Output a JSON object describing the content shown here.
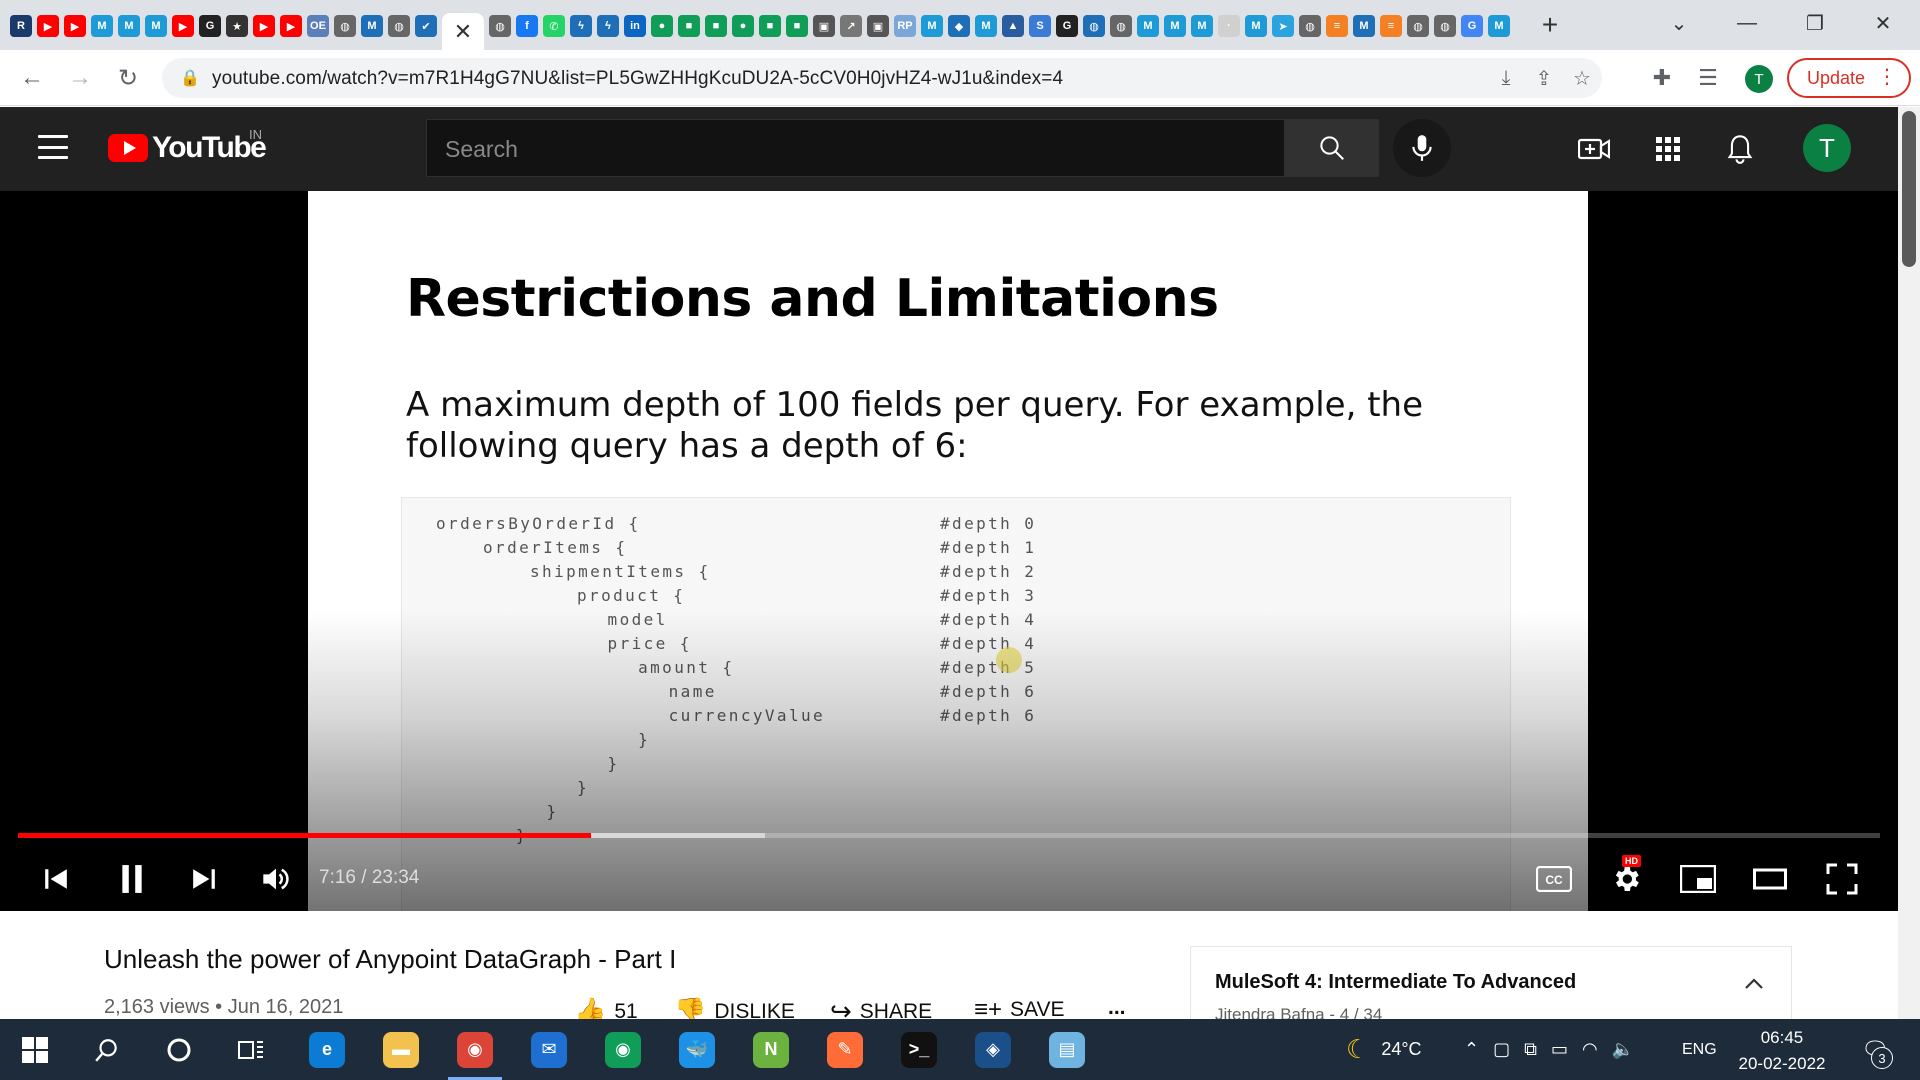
{
  "browser": {
    "tab_favicons": [
      {
        "icon": "r-icon",
        "color": "#1a3a6b",
        "glyph": "R"
      },
      {
        "icon": "youtube-icon",
        "color": "#ff0000",
        "glyph": "▶"
      },
      {
        "icon": "youtube-icon",
        "color": "#ff0000",
        "glyph": "▶"
      },
      {
        "icon": "mulesoft-icon",
        "color": "#1e9ad6",
        "glyph": "M"
      },
      {
        "icon": "mulesoft-icon",
        "color": "#1e9ad6",
        "glyph": "M"
      },
      {
        "icon": "mulesoft-icon",
        "color": "#1e9ad6",
        "glyph": "M"
      },
      {
        "icon": "youtube-icon",
        "color": "#ff0000",
        "glyph": "▶"
      },
      {
        "icon": "github-icon",
        "color": "#222222",
        "glyph": "G"
      },
      {
        "icon": "star-icon",
        "color": "#333333",
        "glyph": "★"
      },
      {
        "icon": "youtube-icon",
        "color": "#ff0000",
        "glyph": "▶"
      },
      {
        "icon": "youtube-icon",
        "color": "#ff0000",
        "glyph": "▶"
      },
      {
        "icon": "oe-icon",
        "color": "#5b7fb8",
        "glyph": "OE"
      },
      {
        "icon": "globe-icon",
        "color": "#666666",
        "glyph": "◍"
      },
      {
        "icon": "m-icon",
        "color": "#1e6fb8",
        "glyph": "M"
      },
      {
        "icon": "globe-icon",
        "color": "#666666",
        "glyph": "◍"
      },
      {
        "icon": "check-icon",
        "color": "#1e6fb8",
        "glyph": "✔"
      },
      {
        "icon": "close-icon",
        "color": "#ffffff",
        "glyph": "✕",
        "active": true
      },
      {
        "icon": "globe-icon",
        "color": "#666666",
        "glyph": "◍"
      },
      {
        "icon": "facebook-icon",
        "color": "#1877f2",
        "glyph": "f"
      },
      {
        "icon": "whatsapp-icon",
        "color": "#25d366",
        "glyph": "✆"
      },
      {
        "icon": "bolt-icon",
        "color": "#1e6fb8",
        "glyph": "ϟ"
      },
      {
        "icon": "bolt-icon",
        "color": "#1e6fb8",
        "glyph": "ϟ"
      },
      {
        "icon": "linkedin-icon",
        "color": "#0a66c2",
        "glyph": "in"
      },
      {
        "icon": "green-dot-icon",
        "color": "#0f9d58",
        "glyph": "●"
      },
      {
        "icon": "green-icon",
        "color": "#0f9d58",
        "glyph": "■"
      },
      {
        "icon": "green-icon",
        "color": "#0f9d58",
        "glyph": "■"
      },
      {
        "icon": "green-dot-icon",
        "color": "#0f9d58",
        "glyph": "●"
      },
      {
        "icon": "green-icon",
        "color": "#0f9d58",
        "glyph": "■"
      },
      {
        "icon": "green-icon",
        "color": "#0f9d58",
        "glyph": "■"
      },
      {
        "icon": "image-icon",
        "color": "#555555",
        "glyph": "▣"
      },
      {
        "icon": "arrow-icon",
        "color": "#777777",
        "glyph": "↗"
      },
      {
        "icon": "image-icon",
        "color": "#555555",
        "glyph": "▣"
      },
      {
        "icon": "rp-icon",
        "color": "#7aa7d8",
        "glyph": "RP"
      },
      {
        "icon": "mulesoft-icon",
        "color": "#1e9ad6",
        "glyph": "M"
      },
      {
        "icon": "shield-icon",
        "color": "#1e6fb8",
        "glyph": "◆"
      },
      {
        "icon": "mulesoft-icon",
        "color": "#1e9ad6",
        "glyph": "M"
      },
      {
        "icon": "cube-icon",
        "color": "#2a5d9f",
        "glyph": "▲"
      },
      {
        "icon": "s-icon",
        "color": "#3a7bd5",
        "glyph": "S"
      },
      {
        "icon": "github-icon",
        "color": "#222222",
        "glyph": "G"
      },
      {
        "icon": "globe-icon",
        "color": "#1e6fb8",
        "glyph": "◍"
      },
      {
        "icon": "globe-icon",
        "color": "#666666",
        "glyph": "◍"
      },
      {
        "icon": "mulesoft-icon",
        "color": "#1e9ad6",
        "glyph": "M"
      },
      {
        "icon": "mulesoft-icon",
        "color": "#1e9ad6",
        "glyph": "M"
      },
      {
        "icon": "mulesoft-icon",
        "color": "#1e9ad6",
        "glyph": "M"
      },
      {
        "icon": "blank-icon",
        "color": "#d0d0d0",
        "glyph": "·"
      },
      {
        "icon": "mulesoft-icon",
        "color": "#1e9ad6",
        "glyph": "M"
      },
      {
        "icon": "telegram-icon",
        "color": "#2aa3df",
        "glyph": "➤"
      },
      {
        "icon": "globe-icon",
        "color": "#666666",
        "glyph": "◍"
      },
      {
        "icon": "stackoverflow-icon",
        "color": "#f48024",
        "glyph": "≡"
      },
      {
        "icon": "m-icon",
        "color": "#1e6fb8",
        "glyph": "M"
      },
      {
        "icon": "stackoverflow-icon",
        "color": "#f48024",
        "glyph": "≡"
      },
      {
        "icon": "globe-icon",
        "color": "#666666",
        "glyph": "◍"
      },
      {
        "icon": "globe-icon",
        "color": "#666666",
        "glyph": "◍"
      },
      {
        "icon": "google-icon",
        "color": "#4285f4",
        "glyph": "G"
      },
      {
        "icon": "mulesoft-icon",
        "color": "#1e9ad6",
        "glyph": "M"
      }
    ],
    "new_tab": "+",
    "url": "youtube.com/watch?v=m7R1H4gG7NU&list=PL5GwZHHgKcuDU2A-5cCV0H0jvHZ4-wJ1u&index=4",
    "profile_initial": "T",
    "update_label": "Update"
  },
  "youtube": {
    "logo_text": "YouTube",
    "region": "IN",
    "search_placeholder": "Search",
    "avatar_initial": "T"
  },
  "player": {
    "slide": {
      "title": "Restrictions and Limitations",
      "body": "A maximum depth of 100 fields per query. For example, the following query has a depth of 6:",
      "code_lines": [
        {
          "text": "ordersByOrderId {",
          "depth": "#depth 0",
          "indent": 0
        },
        {
          "text": "orderItems {",
          "depth": "#depth 1",
          "indent": 1
        },
        {
          "text": "shipmentItems {",
          "depth": "#depth 2",
          "indent": 2
        },
        {
          "text": "product {",
          "depth": "#depth 3",
          "indent": 3
        },
        {
          "text": "model",
          "depth": "#depth 4",
          "indent": 3.65
        },
        {
          "text": "price {",
          "depth": "#depth 4",
          "indent": 3.65
        },
        {
          "text": "amount {",
          "depth": "#depth 5",
          "indent": 4.3
        },
        {
          "text": "name",
          "depth": "#depth 6",
          "indent": 4.95
        },
        {
          "text": "currencyValue",
          "depth": "#depth 6",
          "indent": 4.95
        },
        {
          "text": "}",
          "depth": "",
          "indent": 4.3
        },
        {
          "text": "}",
          "depth": "",
          "indent": 3.65
        },
        {
          "text": "}",
          "depth": "",
          "indent": 3
        },
        {
          "text": "}",
          "depth": "",
          "indent": 2.35
        },
        {
          "text": "}",
          "depth": "",
          "indent": 1.7
        }
      ]
    },
    "time_current": "7:16",
    "time_total": "23:34",
    "time_display": "7:16 / 23:34",
    "progress_fraction": 0.308,
    "buffer_fraction": 0.401,
    "hd_badge": "HD",
    "cc_label": "CC"
  },
  "video": {
    "title": "Unleash the power of Anypoint DataGraph - Part I",
    "views": "2,163 views",
    "date": "Jun 16, 2021",
    "meta_text": "2,163 views • Jun 16, 2021",
    "like_count": "51",
    "dislike_label": "DISLIKE",
    "share_label": "SHARE",
    "save_label": "SAVE",
    "more_label": "..."
  },
  "playlist": {
    "title": "MuleSoft 4: Intermediate To Advanced",
    "meta": "Jitendra Bafna - 4 / 34"
  },
  "taskbar": {
    "apps": [
      {
        "icon": "edge-icon",
        "color": "#0c7bd4",
        "glyph": "e"
      },
      {
        "icon": "file-explorer-icon",
        "color": "#f2c14e",
        "glyph": "▬"
      },
      {
        "icon": "chrome-icon",
        "color": "#db4437",
        "glyph": "◉",
        "active": true
      },
      {
        "icon": "mail-icon",
        "color": "#1f6fd1",
        "glyph": "✉"
      },
      {
        "icon": "chrome-profile-icon",
        "color": "#0f9d58",
        "glyph": "◉"
      },
      {
        "icon": "docker-icon",
        "color": "#1d91e6",
        "glyph": "🐳"
      },
      {
        "icon": "notepadpp-icon",
        "color": "#6bb23f",
        "glyph": "N"
      },
      {
        "icon": "postman-icon",
        "color": "#ff6c37",
        "glyph": "✎"
      },
      {
        "icon": "terminal-icon",
        "color": "#111111",
        "glyph": ">_"
      },
      {
        "icon": "anypoint-studio-icon",
        "color": "#1a4f8a",
        "glyph": "◈"
      },
      {
        "icon": "notepad-icon",
        "color": "#6fb3e0",
        "glyph": "▤"
      }
    ],
    "weather_temp": "24°C",
    "language": "ENG",
    "time": "06:45",
    "date": "20-02-2022",
    "notification_count": "3"
  }
}
